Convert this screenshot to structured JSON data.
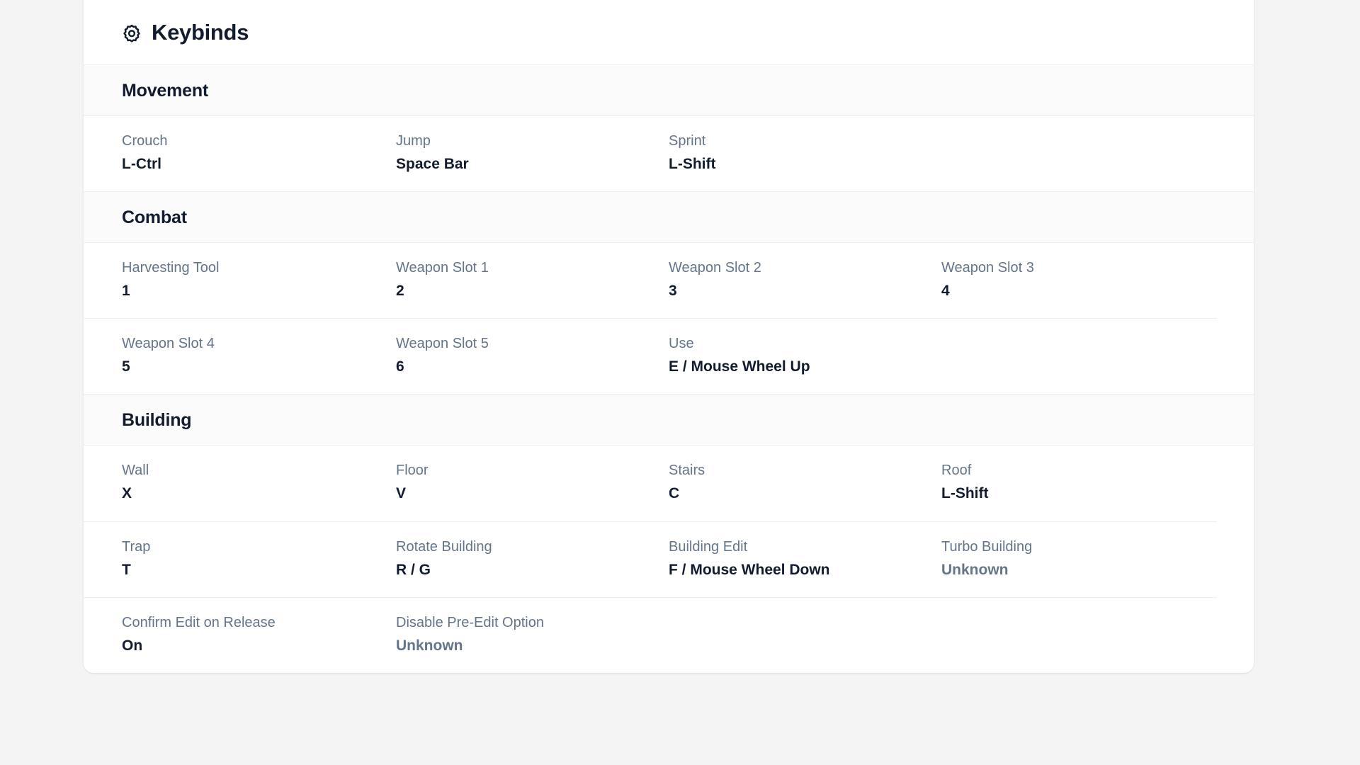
{
  "card": {
    "title": "Keybinds",
    "icon": "gear-icon"
  },
  "colors": {
    "page_background": "#f4f4f5",
    "card_background": "#ffffff",
    "label_text": "#64748b",
    "value_text": "#131c2e",
    "unknown_text": "#64748b",
    "divider": "#eceef1",
    "section_band": "#fbfbfc"
  },
  "sections": [
    {
      "title": "Movement",
      "rows": [
        [
          {
            "label": "Crouch",
            "value": "L-Ctrl",
            "unknown": false
          },
          {
            "label": "Jump",
            "value": "Space Bar",
            "unknown": false
          },
          {
            "label": "Sprint",
            "value": "L-Shift",
            "unknown": false
          },
          {
            "label": "",
            "value": "",
            "empty": true
          }
        ]
      ]
    },
    {
      "title": "Combat",
      "rows": [
        [
          {
            "label": "Harvesting Tool",
            "value": "1",
            "unknown": false
          },
          {
            "label": "Weapon Slot 1",
            "value": "2",
            "unknown": false
          },
          {
            "label": "Weapon Slot 2",
            "value": "3",
            "unknown": false
          },
          {
            "label": "Weapon Slot 3",
            "value": "4",
            "unknown": false
          }
        ],
        [
          {
            "label": "Weapon Slot 4",
            "value": "5",
            "unknown": false
          },
          {
            "label": "Weapon Slot 5",
            "value": "6",
            "unknown": false
          },
          {
            "label": "Use",
            "value": "E / Mouse Wheel Up",
            "unknown": false
          },
          {
            "label": "",
            "value": "",
            "empty": true
          }
        ]
      ]
    },
    {
      "title": "Building",
      "rows": [
        [
          {
            "label": "Wall",
            "value": "X",
            "unknown": false
          },
          {
            "label": "Floor",
            "value": "V",
            "unknown": false
          },
          {
            "label": "Stairs",
            "value": "C",
            "unknown": false
          },
          {
            "label": "Roof",
            "value": "L-Shift",
            "unknown": false
          }
        ],
        [
          {
            "label": "Trap",
            "value": "T",
            "unknown": false
          },
          {
            "label": "Rotate Building",
            "value": "R / G",
            "unknown": false
          },
          {
            "label": "Building Edit",
            "value": "F / Mouse Wheel Down",
            "unknown": false
          },
          {
            "label": "Turbo Building",
            "value": "Unknown",
            "unknown": true
          }
        ],
        [
          {
            "label": "Confirm Edit on Release",
            "value": "On",
            "unknown": false
          },
          {
            "label": "Disable Pre-Edit Option",
            "value": "Unknown",
            "unknown": true
          },
          {
            "label": "",
            "value": "",
            "empty": true
          },
          {
            "label": "",
            "value": "",
            "empty": true
          }
        ]
      ]
    }
  ]
}
